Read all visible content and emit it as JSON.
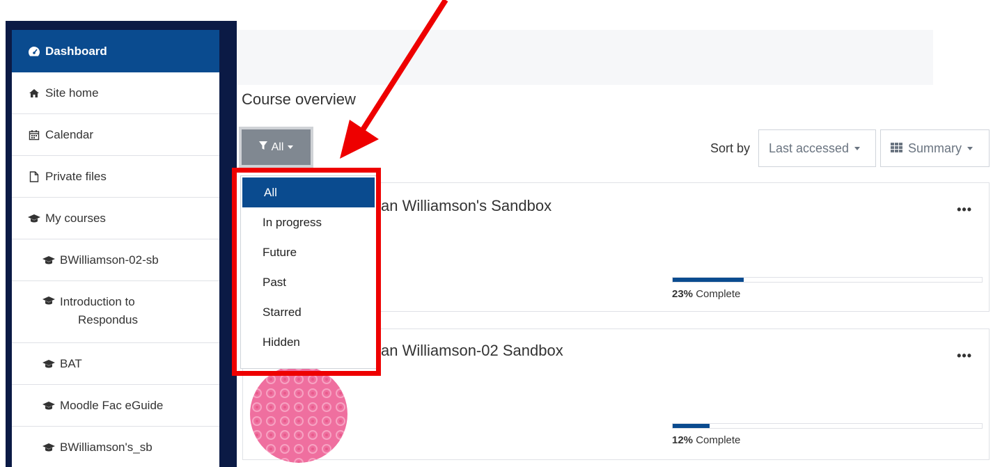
{
  "sidebar": {
    "items": [
      {
        "label": "Dashboard",
        "icon": "dashboard-icon",
        "level": "top",
        "active": true
      },
      {
        "label": "Site home",
        "icon": "home-icon",
        "level": "top"
      },
      {
        "label": "Calendar",
        "icon": "calendar-icon",
        "level": "top"
      },
      {
        "label": "Private files",
        "icon": "file-icon",
        "level": "top"
      },
      {
        "label": "My courses",
        "icon": "graduation-cap-icon",
        "level": "top"
      },
      {
        "label": "BWilliamson-02-sb",
        "icon": "graduation-cap-icon",
        "level": "sub"
      },
      {
        "label_line1": "Introduction to",
        "label_line2": "Respondus",
        "icon": "graduation-cap-icon",
        "level": "sub"
      },
      {
        "label": "BAT",
        "icon": "graduation-cap-icon",
        "level": "sub"
      },
      {
        "label": "Moodle Fac eGuide",
        "icon": "graduation-cap-icon",
        "level": "sub"
      },
      {
        "label": "BWilliamson's_sb",
        "icon": "graduation-cap-icon",
        "level": "sub"
      }
    ]
  },
  "main": {
    "heading": "Course overview",
    "filter": {
      "label": "All",
      "icon": "filter-icon"
    },
    "sort": {
      "label": "Sort by",
      "value": "Last accessed"
    },
    "view": {
      "value": "Summary",
      "icon": "grid-icon"
    }
  },
  "dropdown": {
    "options": [
      "All",
      "In progress",
      "Future",
      "Past",
      "Starred",
      "Hidden"
    ],
    "selected": "All"
  },
  "courses": [
    {
      "title_visible": "an Williamson's Sandbox",
      "progress": 23,
      "progress_pct": "23%",
      "progress_suffix": "Complete",
      "menu": "•••"
    },
    {
      "title_visible": "an Williamson-02 Sandbox",
      "progress": 12,
      "progress_pct": "12%",
      "progress_suffix": "Complete",
      "menu": "•••"
    }
  ],
  "colors": {
    "primary": "#0a4b8f",
    "sidebar_frame": "#0b1a45",
    "annotation": "#ee0000",
    "course_image": "#ef6f9f"
  }
}
